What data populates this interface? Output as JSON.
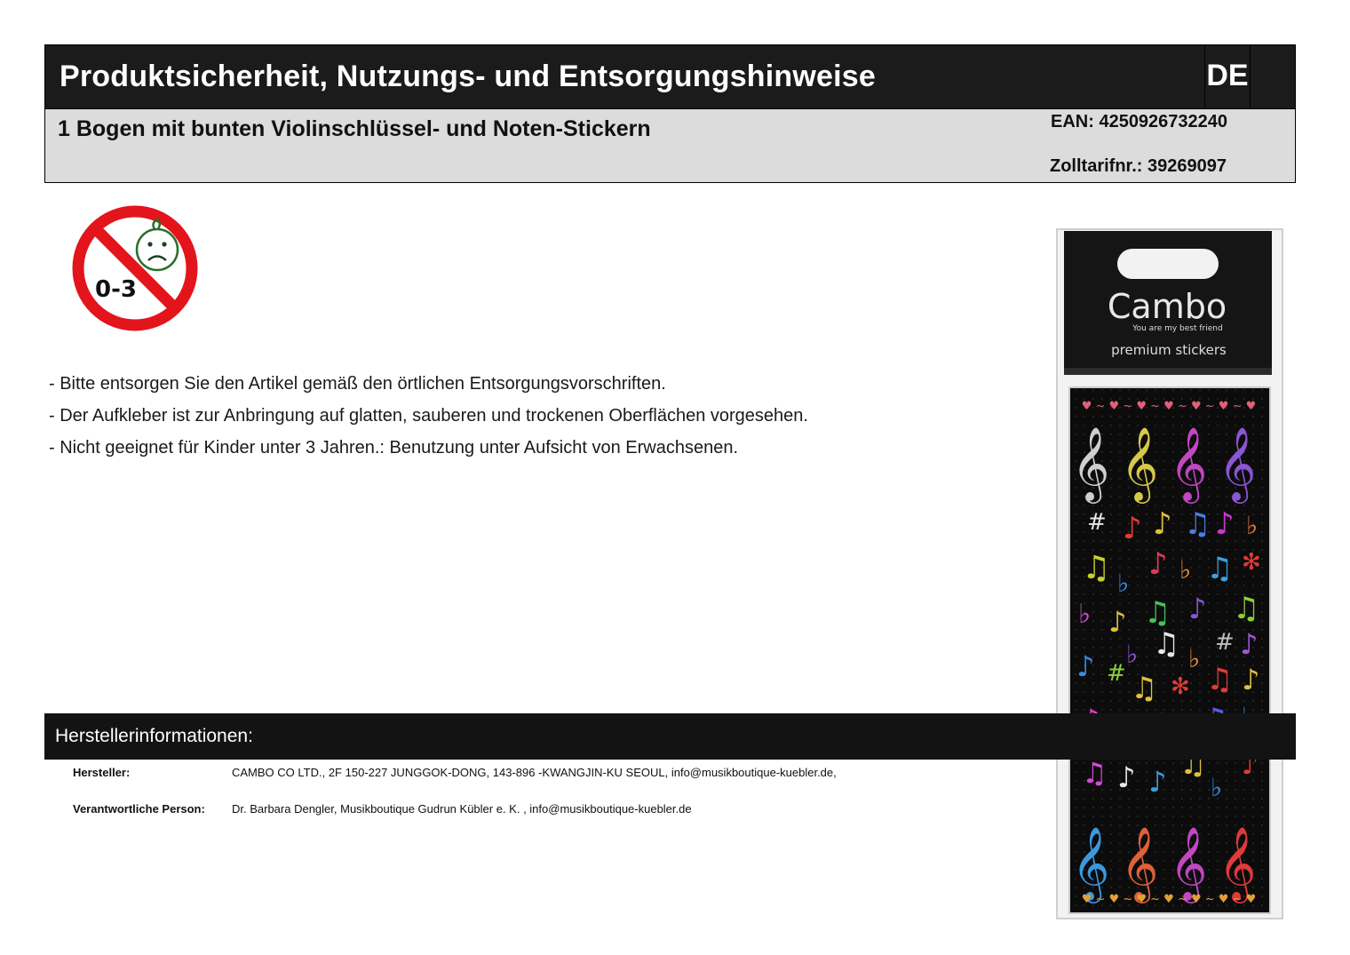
{
  "header": {
    "title": "Produktsicherheit, Nutzungs- und Entsorgungshinweise",
    "language": "DE"
  },
  "product": {
    "name": "1 Bogen mit bunten Violinschlüssel- und Noten-Stickern",
    "ean": "EAN: 4250926732240",
    "customs": "Zolltarifnr.: 39269097"
  },
  "age_warning": {
    "icon": "no-children-0-3-icon",
    "label": "0-3",
    "colors": {
      "ring": "#e3141b",
      "face": "#2c6e2c"
    }
  },
  "notes": [
    "- Bitte entsorgen Sie den Artikel gemäß den örtlichen Entsorgungsvorschriften.",
    "- Der Aufkleber ist zur Anbringung auf glatten, sauberen und trockenen Oberflächen vorgesehen.",
    "- Nicht geeignet für Kinder unter 3 Jahren.: Benutzung unter Aufsicht von Erwachsenen."
  ],
  "product_image": {
    "brand": "Cambo",
    "tagline": "You are my best friend",
    "line": "premium stickers"
  },
  "manufacturer": {
    "section_title": "Herstellerinformationen:",
    "rows": [
      {
        "label": "Hersteller:",
        "value": "CAMBO CO LTD., 2F 150-227 JUNGGOK-DONG, 143-896 -KWANGJIN-KU SEOUL, info@musikboutique-kuebler.de,"
      },
      {
        "label": "Verantwortliche Person:",
        "value": "Dr. Barbara Dengler, Musikboutique Gudrun Kübler e. K. , info@musikboutique-kuebler.de"
      }
    ]
  }
}
